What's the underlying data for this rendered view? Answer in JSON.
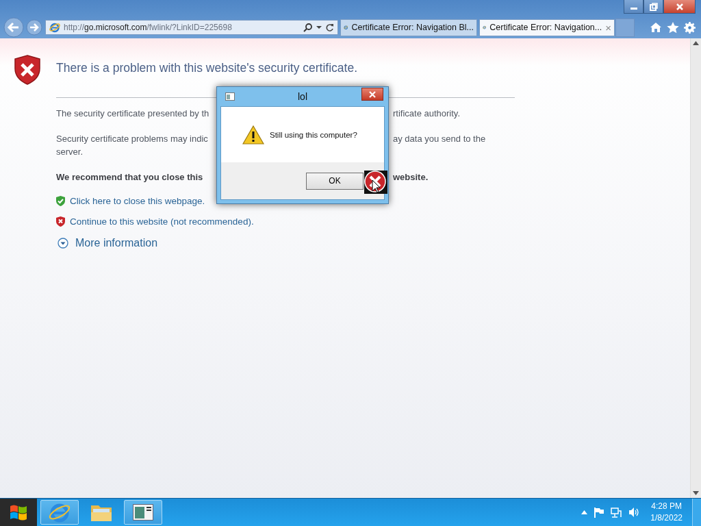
{
  "browser": {
    "address": {
      "prefix": "http://",
      "domain": "go.microsoft.com",
      "suffix": "/fwlink/?LinkID=225698"
    },
    "tabs": [
      {
        "label": "Certificate Error: Navigation Bl...",
        "selected": false
      },
      {
        "label": "Certificate Error: Navigation...",
        "selected": true
      }
    ],
    "tab_close": "×"
  },
  "page": {
    "heading": "There is a problem with this website's security certificate.",
    "paragraphs": [
      {
        "kind": "normal",
        "lines": [
          {
            "left": "The security certificate presented by th",
            "right": "rtificate authority."
          }
        ]
      },
      {
        "kind": "normal",
        "lines": [
          {
            "left": "Security certificate problems may indic",
            "right": "ay data you send to the"
          },
          {
            "left": "server."
          }
        ]
      },
      {
        "kind": "bold",
        "lines": [
          {
            "left": "We recommend that you close this",
            "right": "website."
          }
        ]
      }
    ],
    "links": [
      {
        "label": "Click here to close this webpage.",
        "kind": "safe"
      },
      {
        "label": "Continue to this website (not recommended).",
        "kind": "unsafe"
      }
    ],
    "more_info": "More information"
  },
  "dialog": {
    "title": "lol",
    "message": "Still using this computer?",
    "button": "OK"
  },
  "taskbar": {
    "time": "4:28 PM",
    "date": "1/8/2022"
  }
}
